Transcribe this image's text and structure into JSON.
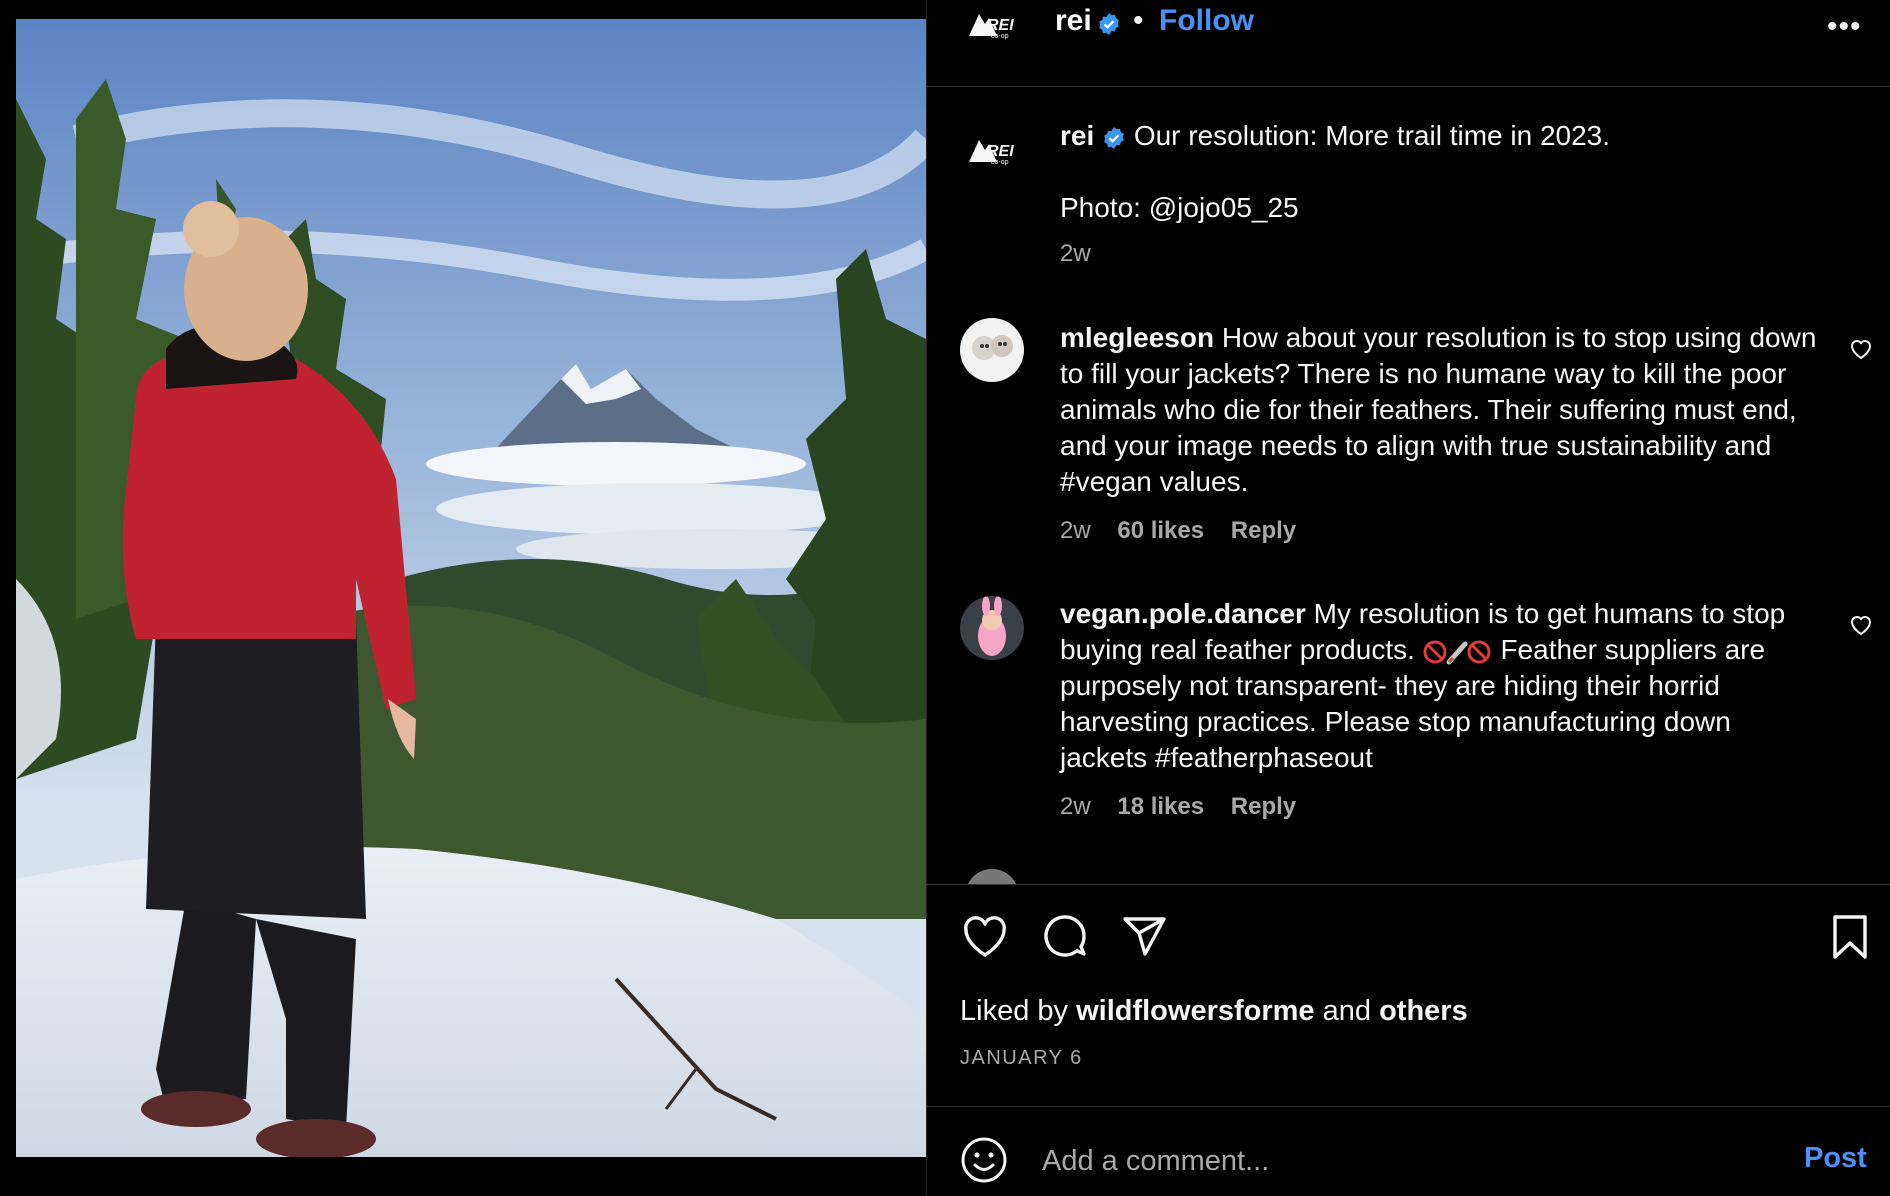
{
  "post": {
    "image_alt": "Hiker in red jacket and beige beanie overlooking snowy forest and mountain peak"
  },
  "header": {
    "username": "rei",
    "separator": "•",
    "follow_label": "Follow",
    "more_icon": "more-horizontal-icon",
    "more_label": "•••"
  },
  "caption": {
    "username": "rei",
    "text_line1": "Our resolution: More trail time in 2023.",
    "text_line2": "Photo: @jojo05_25",
    "time": "2w"
  },
  "comments": [
    {
      "username": "mlegleeson",
      "text": "How about your resolution is to stop using down to fill your jackets? There is no humane way to kill the poor animals who die for their feathers. Their suffering must end, and your image needs to align with true sustainability and #vegan values.",
      "time": "2w",
      "likes": "60 likes",
      "reply": "Reply"
    },
    {
      "username": "vegan.pole.dancer",
      "text_before": "My resolution is to get humans to stop buying real feather products.",
      "text_after": "Feather suppliers are purposely not transparent- they are hiding their horrid harvesting practices. Please stop manufacturing down jackets #featherphaseout",
      "time": "2w",
      "likes": "18 likes",
      "reply": "Reply"
    }
  ],
  "actions": {
    "like_icon": "heart-icon",
    "comment_icon": "comment-icon",
    "share_icon": "send-icon",
    "save_icon": "bookmark-icon"
  },
  "likes": {
    "prefix": "Liked by",
    "user": "wildflowersforme",
    "middle": "and",
    "others": "others"
  },
  "date": "JANUARY 6",
  "comment_box": {
    "placeholder": "Add a comment...",
    "post_label": "Post"
  },
  "colors": {
    "background": "#000000",
    "accent": "#4a90f5",
    "muted": "#a8a8a8",
    "verified": "#3897f0"
  }
}
